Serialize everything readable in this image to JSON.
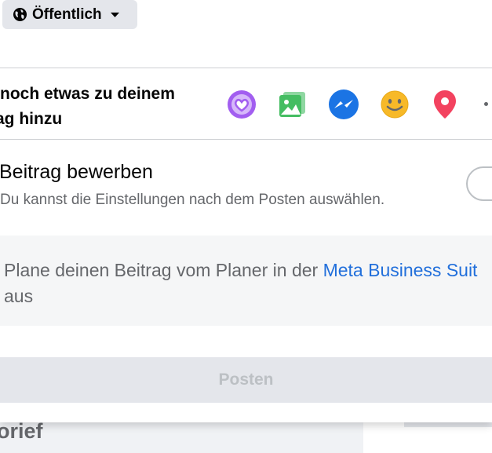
{
  "audience": {
    "label": "Öffentlich"
  },
  "add_to_post": {
    "line1": "noch etwas zu deinem",
    "line2": "ag hinzu"
  },
  "icons": [
    "feeling-heart-icon",
    "photo-icon",
    "messenger-icon",
    "emoji-icon",
    "location-pin-icon",
    "more-icon"
  ],
  "promote": {
    "title": "Beitrag bewerben",
    "description": "Du kannst die Einstellungen nach dem Posten auswählen.",
    "toggle_on": false
  },
  "schedule_info": {
    "text_before": "Plane deinen Beitrag vom Planer in der ",
    "link": "Meta Business Suit",
    "text_after": "aus"
  },
  "post_button": {
    "label": "Posten",
    "enabled": false
  },
  "background": {
    "partial_text": "orief"
  },
  "colors": {
    "link": "#216fdb",
    "purple": "#a25ef0",
    "green": "#45bd62",
    "messenger": "#1b74e4",
    "yellow": "#f7b928",
    "red": "#f3425f"
  }
}
